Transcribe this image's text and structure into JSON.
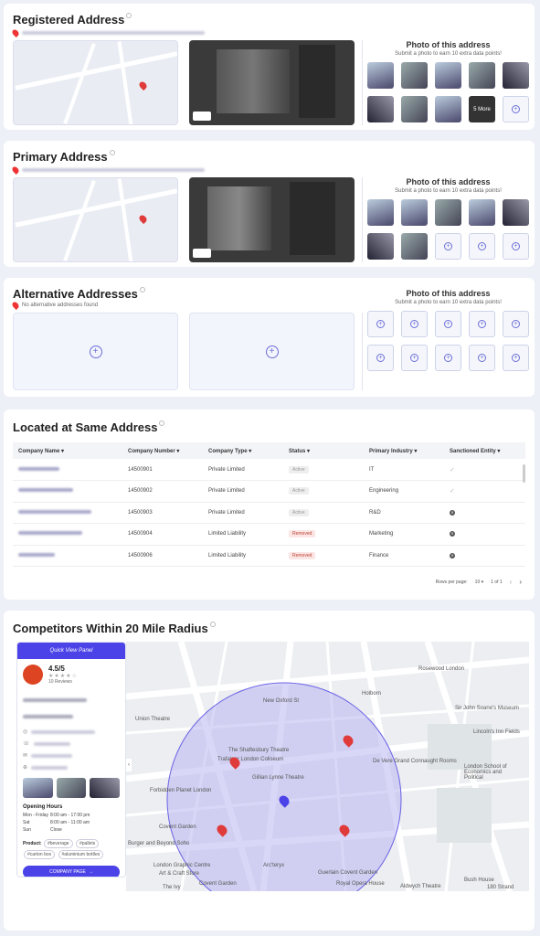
{
  "registered": {
    "title": "Registered Address",
    "photo_title": "Photo of this address",
    "photo_sub": "Submit a photo to earn 10 extra data points!",
    "more_label": "5 More"
  },
  "primary": {
    "title": "Primary Address",
    "photo_title": "Photo of this address",
    "photo_sub": "Submit a photo to earn 10 extra data points!"
  },
  "alternative": {
    "title": "Alternative Addresses",
    "empty_note": "No alternative addresses found",
    "photo_title": "Photo of this address",
    "photo_sub": "Submit a photo to earn 10 extra data points!"
  },
  "same_address": {
    "title": "Located at Same Address",
    "columns": [
      "Company Name",
      "Company Number",
      "Company Type",
      "Status",
      "Primary Industry",
      "Sanctioned Entity"
    ],
    "rows": [
      {
        "number": "14500901",
        "type": "Private Limited",
        "status": "Active",
        "industry": "IT",
        "sanctioned": "check"
      },
      {
        "number": "14500902",
        "type": "Private Limited",
        "status": "Active",
        "industry": "Engineering",
        "sanctioned": "check"
      },
      {
        "number": "14500903",
        "type": "Private Limited",
        "status": "Active",
        "industry": "R&D",
        "sanctioned": "x"
      },
      {
        "number": "14500904",
        "type": "Limited Liability",
        "status": "Removed",
        "industry": "Marketing",
        "sanctioned": "x"
      },
      {
        "number": "14500906",
        "type": "Limited Liability",
        "status": "Removed",
        "industry": "Finance",
        "sanctioned": "x"
      }
    ],
    "rows_per_page_label": "Rows per page:",
    "rows_per_page": "10",
    "page_info": "1 of 1"
  },
  "competitors": {
    "title": "Competitors Within 20 Mile Radius",
    "panel_header": "Quick View Panel",
    "rating": "4.5/5",
    "reviews": "10 Reviews",
    "opening_hours_title": "Opening Hours",
    "hours": [
      {
        "day": "Mon - Friday",
        "time": "8:00 am - 17:00 pm"
      },
      {
        "day": "Sat",
        "time": "8:00 am - 11:00 am"
      },
      {
        "day": "Sun",
        "time": "Close"
      }
    ],
    "product_label": "Product:",
    "product_tags": [
      "#beverage",
      "#pallets",
      "#carton box",
      "#aluminium bottles"
    ],
    "company_page_label": "COMPANY PAGE",
    "map_labels": [
      "Rosewood London",
      "Holborn",
      "Sir John Soane's Museum",
      "Lincoln's Inn Fields",
      "London School of Economics and Political",
      "New Oxford St",
      "The Shaftesbury Theatre",
      "Trafalgar London Coliseum",
      "Gillian Lynne Theatre",
      "De Vere Grand Connaught Rooms",
      "Forbidden Planet London",
      "Covent Garden",
      "London Graphic Centre",
      "Art & Craft Store",
      "Arc'teryx",
      "Royal Opera House",
      "Aldwych Theatre",
      "Bush House",
      "Guerlain Covent Garden",
      "The Ivy",
      "Covent Garden",
      "180 Strand",
      "Burger and Beyond Soho",
      "Union Theatre"
    ]
  },
  "colors": {
    "accent": "#4b42e8",
    "pin_red": "#e03b3b",
    "radius_fill": "#b9b6f0"
  }
}
